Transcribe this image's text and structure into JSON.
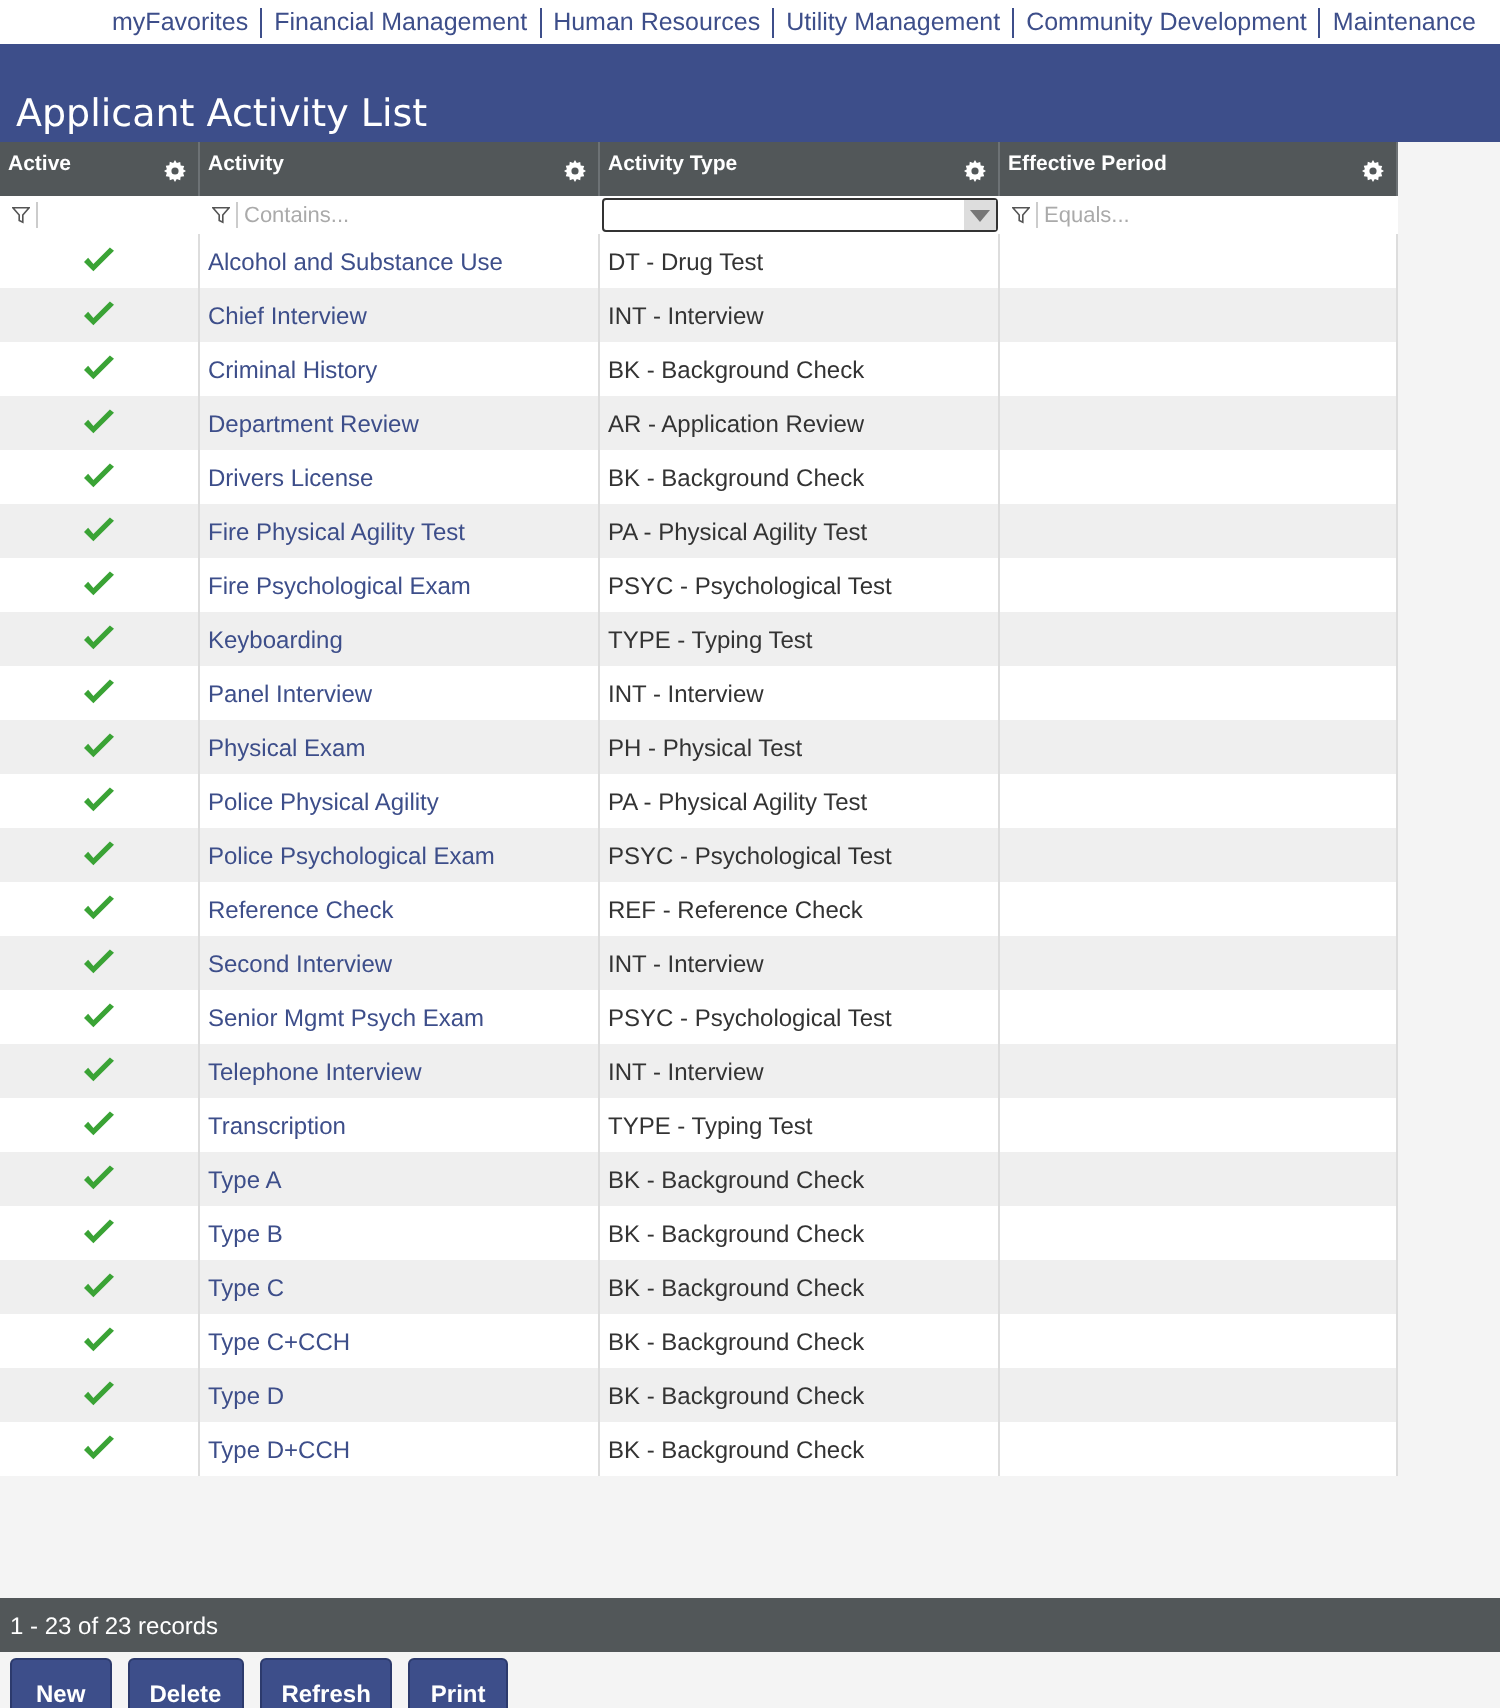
{
  "nav": [
    "myFavorites",
    "Financial Management",
    "Human Resources",
    "Utility Management",
    "Community Development",
    "Maintenance"
  ],
  "title": "Applicant Activity List",
  "columns": [
    {
      "label": "Active",
      "kind": "blank"
    },
    {
      "label": "Activity",
      "kind": "text",
      "placeholder": "Contains..."
    },
    {
      "label": "Activity Type",
      "kind": "select"
    },
    {
      "label": "Effective Period",
      "kind": "text",
      "placeholder": "Equals..."
    }
  ],
  "rows": [
    {
      "active": true,
      "activity": "Alcohol and Substance Use",
      "type": "DT - Drug Test"
    },
    {
      "active": true,
      "activity": "Chief Interview",
      "type": "INT - Interview"
    },
    {
      "active": true,
      "activity": "Criminal History",
      "type": "BK - Background Check"
    },
    {
      "active": true,
      "activity": "Department Review",
      "type": "AR - Application Review"
    },
    {
      "active": true,
      "activity": "Drivers License",
      "type": "BK - Background Check"
    },
    {
      "active": true,
      "activity": "Fire Physical Agility Test",
      "type": "PA - Physical Agility Test"
    },
    {
      "active": true,
      "activity": "Fire Psychological Exam",
      "type": "PSYC - Psychological Test"
    },
    {
      "active": true,
      "activity": "Keyboarding",
      "type": "TYPE - Typing Test"
    },
    {
      "active": true,
      "activity": "Panel Interview",
      "type": "INT - Interview"
    },
    {
      "active": true,
      "activity": "Physical Exam",
      "type": "PH - Physical Test"
    },
    {
      "active": true,
      "activity": "Police Physical Agility",
      "type": "PA - Physical Agility Test"
    },
    {
      "active": true,
      "activity": "Police Psychological Exam",
      "type": "PSYC - Psychological Test"
    },
    {
      "active": true,
      "activity": "Reference Check",
      "type": "REF - Reference Check"
    },
    {
      "active": true,
      "activity": "Second Interview",
      "type": "INT - Interview"
    },
    {
      "active": true,
      "activity": "Senior Mgmt Psych Exam",
      "type": "PSYC - Psychological Test"
    },
    {
      "active": true,
      "activity": "Telephone Interview",
      "type": "INT - Interview"
    },
    {
      "active": true,
      "activity": "Transcription",
      "type": "TYPE - Typing Test"
    },
    {
      "active": true,
      "activity": "Type A",
      "type": "BK - Background Check"
    },
    {
      "active": true,
      "activity": "Type B",
      "type": "BK - Background Check"
    },
    {
      "active": true,
      "activity": "Type C",
      "type": "BK - Background Check"
    },
    {
      "active": true,
      "activity": "Type C+CCH",
      "type": "BK - Background Check"
    },
    {
      "active": true,
      "activity": "Type D",
      "type": "BK - Background Check"
    },
    {
      "active": true,
      "activity": "Type D+CCH",
      "type": "BK - Background Check"
    }
  ],
  "status": "1 - 23 of 23 records",
  "buttons": [
    "New",
    "Delete",
    "Refresh",
    "Print"
  ]
}
